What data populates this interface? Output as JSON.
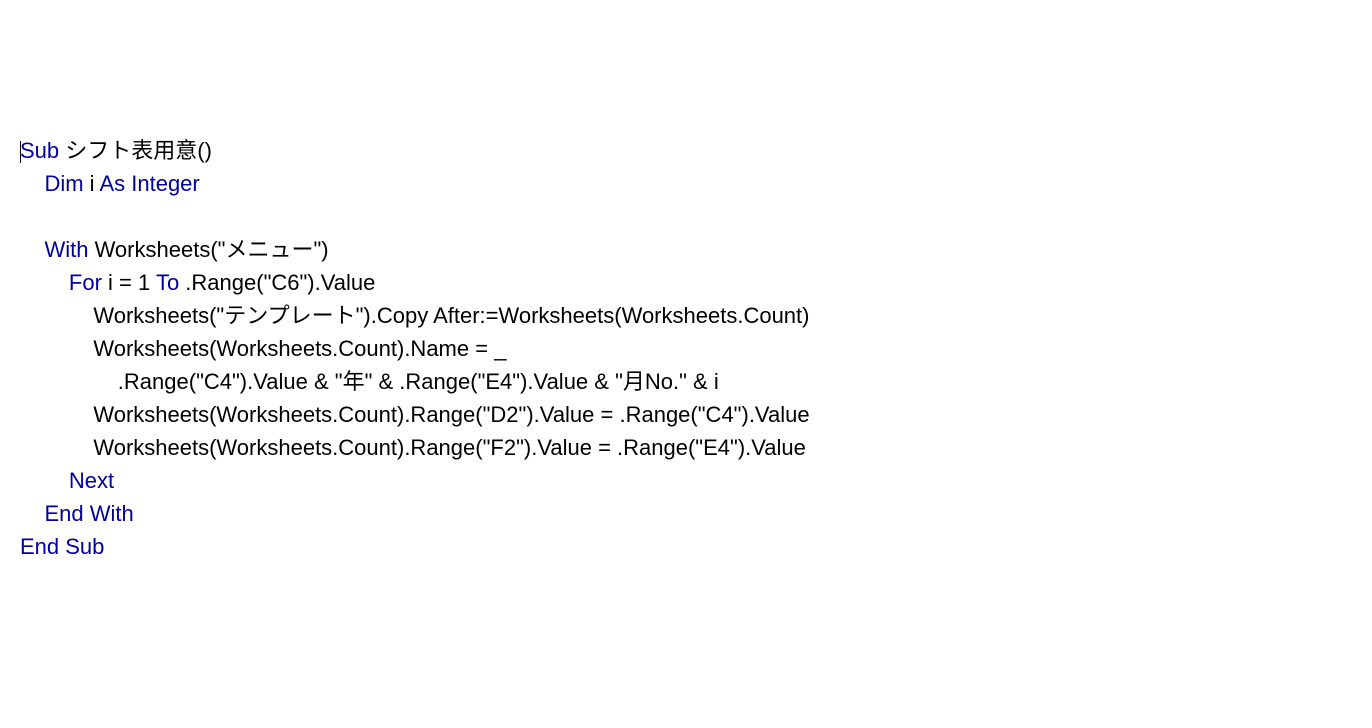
{
  "code": {
    "l1_kw1": "Sub",
    "l1_txt1": " シフト表用意()",
    "l2_kw1": "Dim",
    "l2_txt1": " i ",
    "l2_kw2": "As Integer",
    "l4_kw1": "With",
    "l4_txt1": " Worksheets(\"メニュー\")",
    "l5_kw1": "For",
    "l5_txt1": " i = 1 ",
    "l5_kw2": "To",
    "l5_txt2": " .Range(\"C6\").Value",
    "l6_txt1": "Worksheets(\"テンプレート\").Copy After:=Worksheets(Worksheets.Count)",
    "l7_txt1": "Worksheets(Worksheets.Count).Name = _",
    "l8_txt1": ".Range(\"C4\").Value & \"年\" & .Range(\"E4\").Value & \"月No.\" & i",
    "l9_txt1": "Worksheets(Worksheets.Count).Range(\"D2\").Value = .Range(\"C4\").Value",
    "l10_txt1": "Worksheets(Worksheets.Count).Range(\"F2\").Value = .Range(\"E4\").Value",
    "l11_kw1": "Next",
    "l12_kw1": "End With",
    "l13_kw1": "End Sub"
  },
  "indent": {
    "i0": "",
    "i1": "    ",
    "i2": "        ",
    "i3": "            ",
    "i4": "                "
  }
}
